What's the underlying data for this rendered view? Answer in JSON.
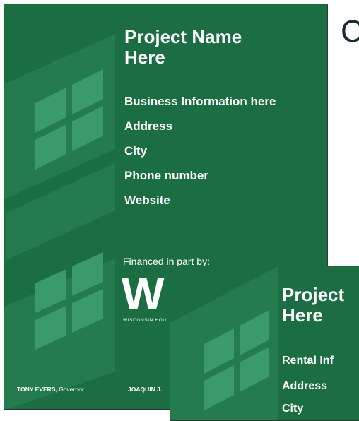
{
  "main_sign": {
    "title_line1": "Project Name",
    "title_line2": "Here",
    "info_lines": [
      "Business Information here",
      "Address",
      "City",
      "Phone number",
      "Website"
    ],
    "financed_by": "Financed in part by:",
    "logo_letter": "W",
    "logo_subtitle": "WISCONSIN HOU",
    "footer_name": "TONY EVERS,",
    "footer_title": "Governor",
    "footer_second": "JOAQUIN J."
  },
  "second_sign": {
    "title_line1": "Project",
    "title_line2": "Here",
    "info_lines": [
      "Rental Inf",
      "Address",
      "City"
    ]
  },
  "side_text": "C",
  "colors": {
    "sign_green": "#1b6e42",
    "pane_green": "#2f8c5e"
  }
}
